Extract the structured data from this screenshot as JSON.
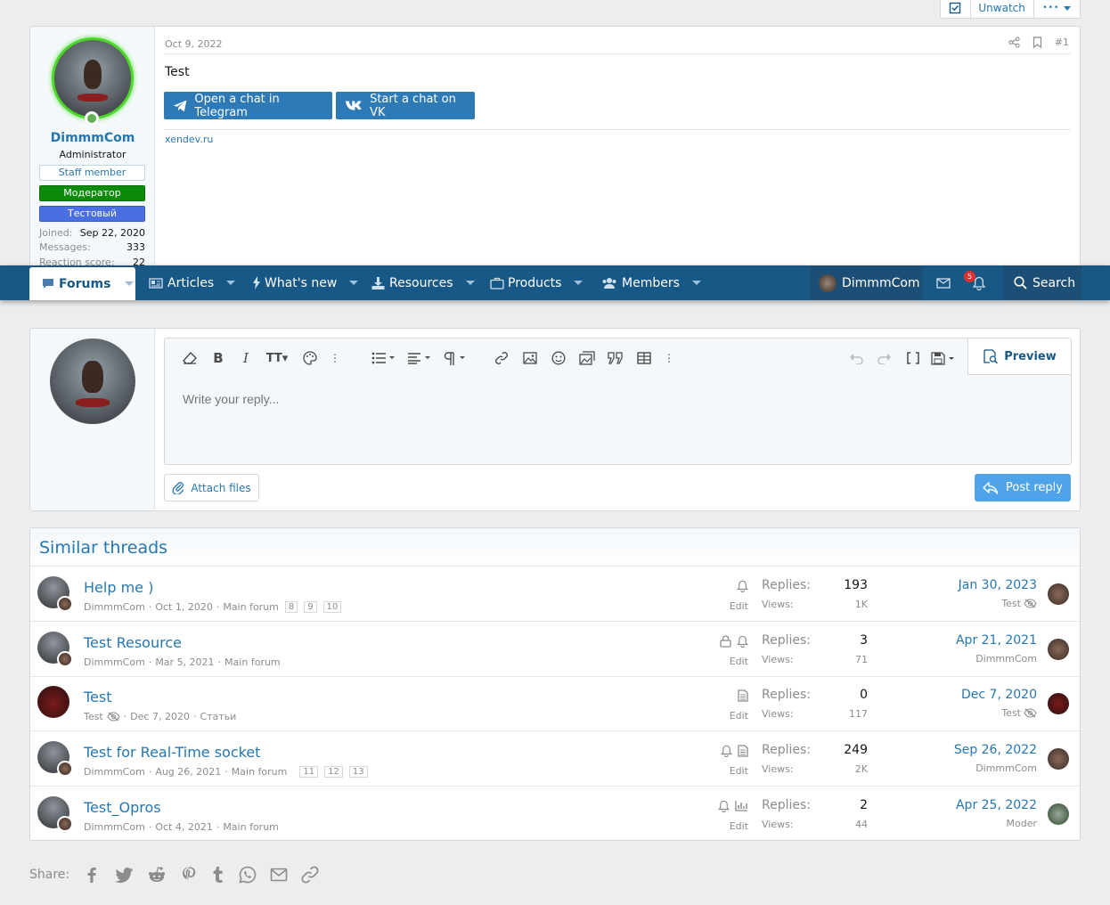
{
  "watchbar": {
    "unwatch": "Unwatch",
    "more": "•••"
  },
  "post": {
    "user": {
      "name": "DimmmCom",
      "title": "Administrator",
      "badges": [
        "Staff member",
        "Модератор",
        "Тестовый"
      ]
    },
    "stats": [
      {
        "k": "Joined:",
        "v": "Sep 22, 2020"
      },
      {
        "k": "Messages:",
        "v": "333"
      },
      {
        "k": "Reaction score:",
        "v": "22"
      }
    ],
    "date": "Oct 9, 2022",
    "number": "#1",
    "text": "Test",
    "telegram": "Open a chat in Telegram",
    "vk": "Start a chat on VK",
    "signature": "xendev.ru"
  },
  "nav": {
    "forums": "Forums",
    "articles": "Articles",
    "whatsnew": "What's new",
    "resources": "Resources",
    "products": "Products",
    "members": "Members",
    "user": "DimmmCom",
    "alerts": "5",
    "search": "Search"
  },
  "reply": {
    "placeholder": "Write your reply...",
    "preview": "Preview",
    "attach": "Attach files",
    "post": "Post reply"
  },
  "similar": {
    "title": "Similar threads",
    "replies_label": "Replies:",
    "views_label": "Views:",
    "edit": "Edit",
    "threads": [
      {
        "title": "Help me )",
        "author": "DimmmCom",
        "date": "Oct 1, 2020",
        "forum": "Main forum",
        "pages": [
          "8",
          "9",
          "10"
        ],
        "replies": "193",
        "views": "1K",
        "last_date": "Jan 30, 2023",
        "last_user": "Test"
      },
      {
        "title": "Test Resource",
        "author": "DimmmCom",
        "date": "Mar 5, 2021",
        "forum": "Main forum",
        "pages": [],
        "replies": "3",
        "views": "71",
        "last_date": "Apr 21, 2021",
        "last_user": "DimmmCom"
      },
      {
        "title": "Test",
        "author": "Test",
        "date": "Dec 7, 2020",
        "forum": "Статьи",
        "pages": [],
        "replies": "0",
        "views": "117",
        "last_date": "Dec 7, 2020",
        "last_user": "Test"
      },
      {
        "title": "Test for Real-Time socket",
        "author": "DimmmCom",
        "date": "Aug 26, 2021",
        "forum": "Main forum",
        "pages": [
          "11",
          "12",
          "13"
        ],
        "replies": "249",
        "views": "2K",
        "last_date": "Sep 26, 2022",
        "last_user": "DimmmCom"
      },
      {
        "title": "Test_Opros",
        "author": "DimmmCom",
        "date": "Oct 4, 2021",
        "forum": "Main forum",
        "pages": [],
        "replies": "2",
        "views": "44",
        "last_date": "Apr 25, 2022",
        "last_user": "Moder"
      }
    ]
  },
  "share": {
    "label": "Share:"
  }
}
